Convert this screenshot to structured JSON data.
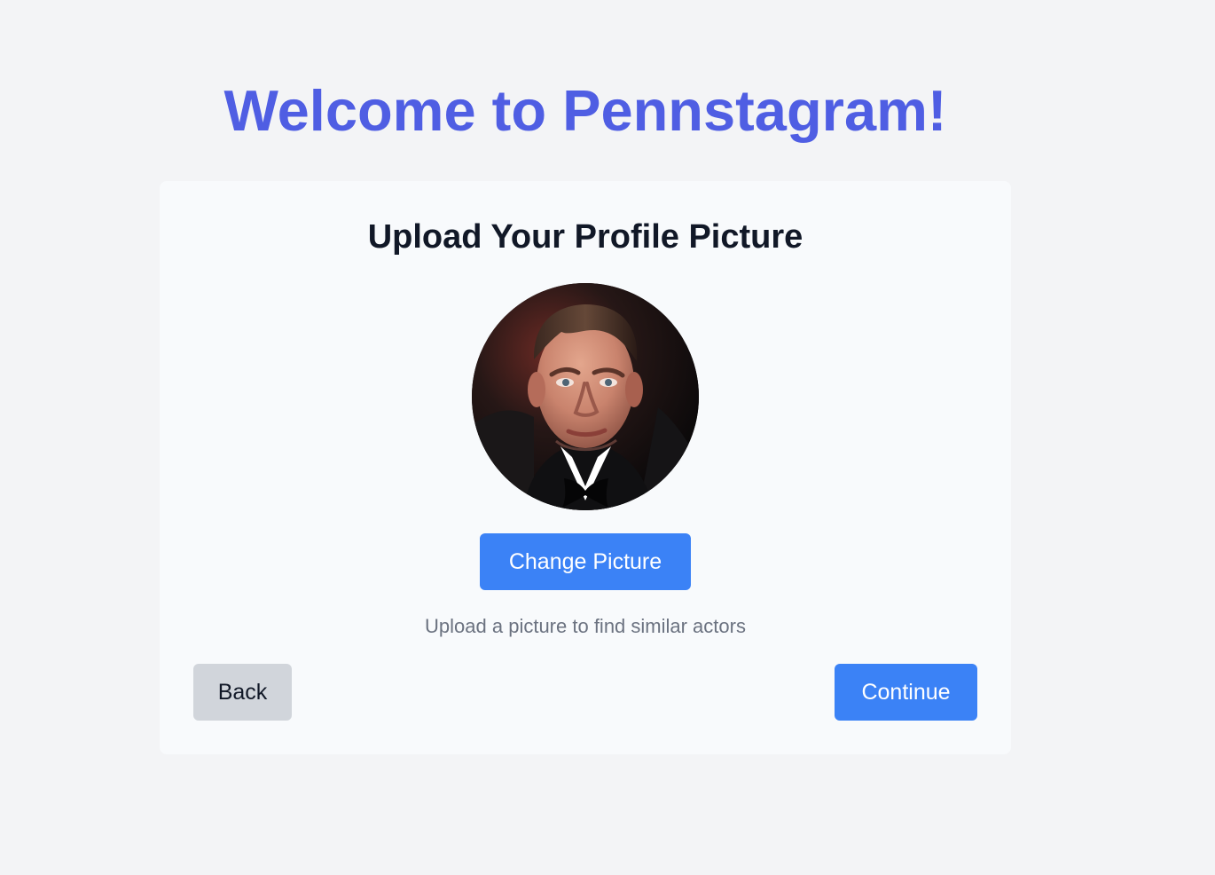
{
  "app": {
    "title": "Welcome to Pennstagram!"
  },
  "upload": {
    "title": "Upload Your Profile Picture",
    "avatar_alt": "profile-picture",
    "change_button": "Change Picture",
    "hint": "Upload a picture to find similar actors"
  },
  "nav": {
    "back_label": "Back",
    "continue_label": "Continue"
  },
  "colors": {
    "background": "#f3f4f6",
    "card": "#f8fafc",
    "accent_title": "#4f5ee3",
    "primary_button": "#3b82f6",
    "secondary_button": "#d1d5db",
    "text_dark": "#111827",
    "text_muted": "#6b7280"
  }
}
